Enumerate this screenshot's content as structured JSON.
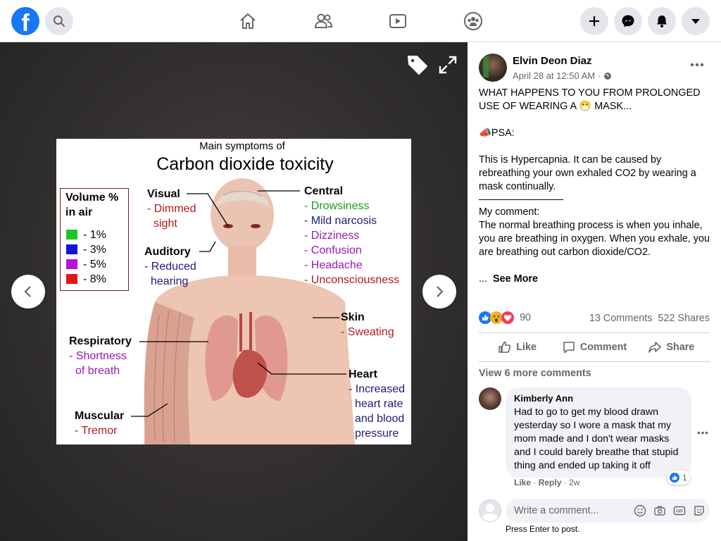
{
  "topbar": {
    "logo_letter": "f",
    "icons": [
      "search-icon",
      "home-icon",
      "friends-icon",
      "watch-icon",
      "groups-icon",
      "create-icon",
      "messenger-icon",
      "notifications-icon",
      "account-menu-icon"
    ]
  },
  "viewer": {
    "infographic": {
      "subtitle": "Main symptoms of",
      "title": "Carbon dioxide toxicity",
      "legend": {
        "title1": "Volume %",
        "title2": "in air",
        "items": [
          {
            "label": "- 1%",
            "color": "#1fc61f"
          },
          {
            "label": "- 3%",
            "color": "#1313e0"
          },
          {
            "label": "- 5%",
            "color": "#b515d8"
          },
          {
            "label": "- 8%",
            "color": "#e51414"
          }
        ]
      },
      "visual": {
        "heading": "Visual",
        "l1": "- Dimmed",
        "l2": "sight"
      },
      "auditory": {
        "heading": "Auditory",
        "l1": "- Reduced",
        "l2": "hearing"
      },
      "central": {
        "heading": "Central",
        "items": [
          "- Drowsiness",
          "- Mild narcosis",
          "- Dizziness",
          "- Confusion",
          "- Headache",
          "- Unconsciousness"
        ]
      },
      "skin": {
        "heading": "Skin",
        "l1": "- Sweating"
      },
      "respiratory": {
        "heading": "Respiratory",
        "l1": "- Shortness",
        "l2": "of breath"
      },
      "heart": {
        "heading": "Heart",
        "l1": "- Increased",
        "l2": "heart rate",
        "l3": "and blood",
        "l4": "pressure"
      },
      "muscular": {
        "heading": "Muscular",
        "l1": "- Tremor"
      }
    }
  },
  "post": {
    "author": "Elvin Deon Diaz",
    "date": "April 28 at 12:50 AM",
    "meta_sep": "·",
    "text1": "WHAT HAPPENS TO YOU FROM PROLONGED USE OF WEARING A 😷 MASK...",
    "text2": "📣PSA:",
    "text3": "This is Hypercapnia. It can be caused by rebreathing your own exhaled CO2 by wearing a mask continually.",
    "text4": "My comment:",
    "text5": "The normal breathing process is when you inhale, you are breathing in oxygen. When you exhale, you are breathing out carbon dioxide/CO2.",
    "ellipsis": "...",
    "see_more": "See More",
    "reaction_count": "90",
    "comments": "13 Comments",
    "shares": "522 Shares",
    "actions": {
      "like": "Like",
      "comment": "Comment",
      "share": "Share"
    }
  },
  "comments": {
    "view_more": "View 6 more comments",
    "items": [
      {
        "author": "Kimberly Ann",
        "text": "Had to go to get my blood drawn yesterday so I wore a mask that my mom made and I don't wear masks and I could barely breathe that stupid thing and ended up taking it off",
        "like": "Like",
        "reply": "Reply",
        "time": "2w",
        "sep": "·",
        "likes": "1"
      }
    ],
    "input_placeholder": "Write a comment...",
    "enter_hint": "Press Enter to post."
  },
  "colors": {
    "brand": "#1877f2",
    "infographic_green": "#1a9e1a",
    "infographic_blue": "#1c1c7a",
    "infographic_purple": "#9a1ab0",
    "infographic_red": "#b01a1a"
  }
}
